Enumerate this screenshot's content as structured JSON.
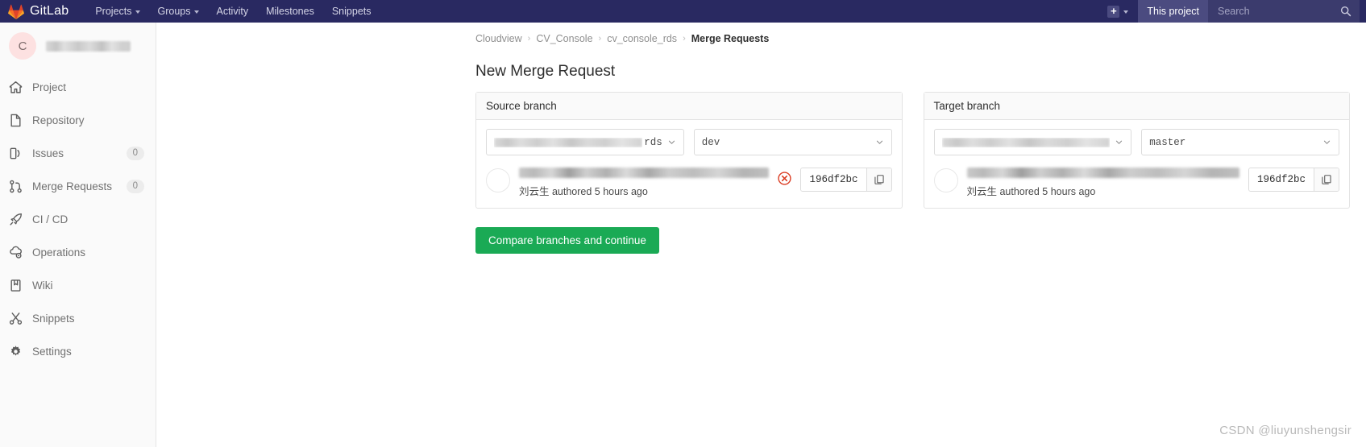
{
  "navbar": {
    "brand": "GitLab",
    "links": [
      {
        "label": "Projects",
        "has_caret": true
      },
      {
        "label": "Groups",
        "has_caret": true
      },
      {
        "label": "Activity",
        "has_caret": false
      },
      {
        "label": "Milestones",
        "has_caret": false
      },
      {
        "label": "Snippets",
        "has_caret": false
      }
    ],
    "plus_icon": "plus-square-icon",
    "plus_caret": "chevron-down-icon",
    "scope_label": "This project",
    "search_placeholder": "Search",
    "search_value": "",
    "search_icon": "search-icon",
    "bg_color": "#292961"
  },
  "sidebar": {
    "avatar_initial": "C",
    "project_name_redacted": "",
    "items": [
      {
        "label": "Project",
        "icon": "home-icon",
        "count": null
      },
      {
        "label": "Repository",
        "icon": "document-icon",
        "count": null
      },
      {
        "label": "Issues",
        "icon": "issues-icon",
        "count": "0"
      },
      {
        "label": "Merge Requests",
        "icon": "merge-request-icon",
        "count": "0"
      },
      {
        "label": "CI / CD",
        "icon": "rocket-icon",
        "count": null
      },
      {
        "label": "Operations",
        "icon": "cloud-gear-icon",
        "count": null
      },
      {
        "label": "Wiki",
        "icon": "book-icon",
        "count": null
      },
      {
        "label": "Snippets",
        "icon": "scissors-icon",
        "count": null
      },
      {
        "label": "Settings",
        "icon": "gear-icon",
        "count": null
      }
    ]
  },
  "breadcrumb": {
    "items": [
      "Cloudview",
      "CV_Console",
      "cv_console_rds"
    ],
    "current": "Merge Requests",
    "separator": "›"
  },
  "page": {
    "title": "New Merge Request",
    "compare_button": "Compare branches and continue"
  },
  "source_branch": {
    "panel_title": "Source branch",
    "project_value_redacted": "",
    "project_value_tail": "rds",
    "branch_value": "dev",
    "commit_message_redacted": "",
    "commit_author_line": "刘云生 authored 5 hours ago",
    "commit_sha": "196df2bc",
    "status_icon": "error-circle-icon",
    "copy_icon": "copy-icon",
    "chevron_icon": "chevron-down-icon"
  },
  "target_branch": {
    "panel_title": "Target branch",
    "project_value_redacted": "",
    "project_value_tail": "",
    "branch_value": "master",
    "commit_message_redacted": "",
    "commit_author_line": "刘云生 authored 5 hours ago",
    "commit_sha": "196df2bc",
    "copy_icon": "copy-icon",
    "chevron_icon": "chevron-down-icon"
  },
  "watermark": "CSDN @liuyunshengsir",
  "colors": {
    "navbar_bg": "#292961",
    "primary_green": "#1aaa55",
    "error_red": "#db3b21",
    "avatar_bg": "#fde1e1"
  }
}
